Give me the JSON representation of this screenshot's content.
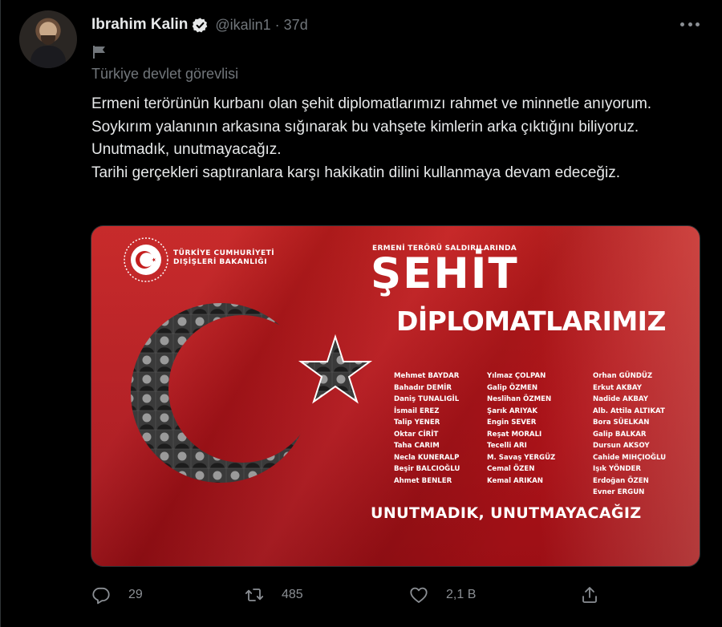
{
  "tweet": {
    "author_name": "Ibrahim Kalin",
    "handle": "@ikalin1",
    "separator": "·",
    "time": "37d",
    "account_label": "Türkiye devlet görevlisi",
    "text": "Ermeni terörünün kurbanı olan şehit diplomatlarımızı rahmet ve minnetle anıyorum. Soykırım yalanının arkasına sığınarak bu vahşete kimlerin arka çıktığını biliyoruz. Unutmadık, unutmayacağız.\nTarihi gerçekleri saptıranlara karşı hakikatin dilini kullanmaya devam edeceğiz."
  },
  "image": {
    "ministry": "TÜRKİYE CUMHURİYETİ\nDIŞİŞLERİ BAKANLIĞI",
    "subtitle": "ERMENİ TERÖRÜ SALDIRILARINDA",
    "title_line1": "ŞEHİT",
    "title_line2": "DİPLOMATLARIMIZ",
    "names_col1": [
      "Mehmet BAYDAR",
      "Bahadır DEMİR",
      "Daniş TUNALIGİL",
      "İsmail EREZ",
      "Talip YENER",
      "Oktar CİRİT",
      "Taha CARIM",
      "Necla KUNERALP",
      "Beşir BALCIOĞLU",
      "Ahmet BENLER"
    ],
    "names_col2": [
      "Yılmaz ÇOLPAN",
      "Galip ÖZMEN",
      "Neslihan ÖZMEN",
      "Şarık ARIYAK",
      "Engin SEVER",
      "Reşat MORALI",
      "Tecelli ARI",
      "M. Savaş YERGÜZ",
      "Cemal ÖZEN",
      "Kemal ARIKAN"
    ],
    "names_col3": [
      "Orhan GÜNDÜZ",
      "Erkut AKBAY",
      "Nadide AKBAY",
      "Alb. Attila ALTIKAT",
      "Bora SÜELKAN",
      "Galip BALKAR",
      "Dursun AKSOY",
      "Cahide MIHÇIOĞLU",
      "Işık YÖNDER",
      "Erdoğan ÖZEN",
      "Evner ERGUN"
    ],
    "slogan": "UNUTMADIK, UNUTMAYACAĞIZ"
  },
  "actions": {
    "replies": "29",
    "retweets": "485",
    "likes": "2,1 B"
  },
  "icons": {
    "verified": "verified-badge-icon",
    "more": "more-dots-icon",
    "flag": "flag-icon",
    "reply": "reply-icon",
    "retweet": "retweet-icon",
    "like": "heart-icon",
    "share": "share-icon"
  },
  "colors": {
    "background": "#000000",
    "text_primary": "#e7e9ea",
    "text_secondary": "#71767b",
    "flag_red": "#c41e1e"
  }
}
